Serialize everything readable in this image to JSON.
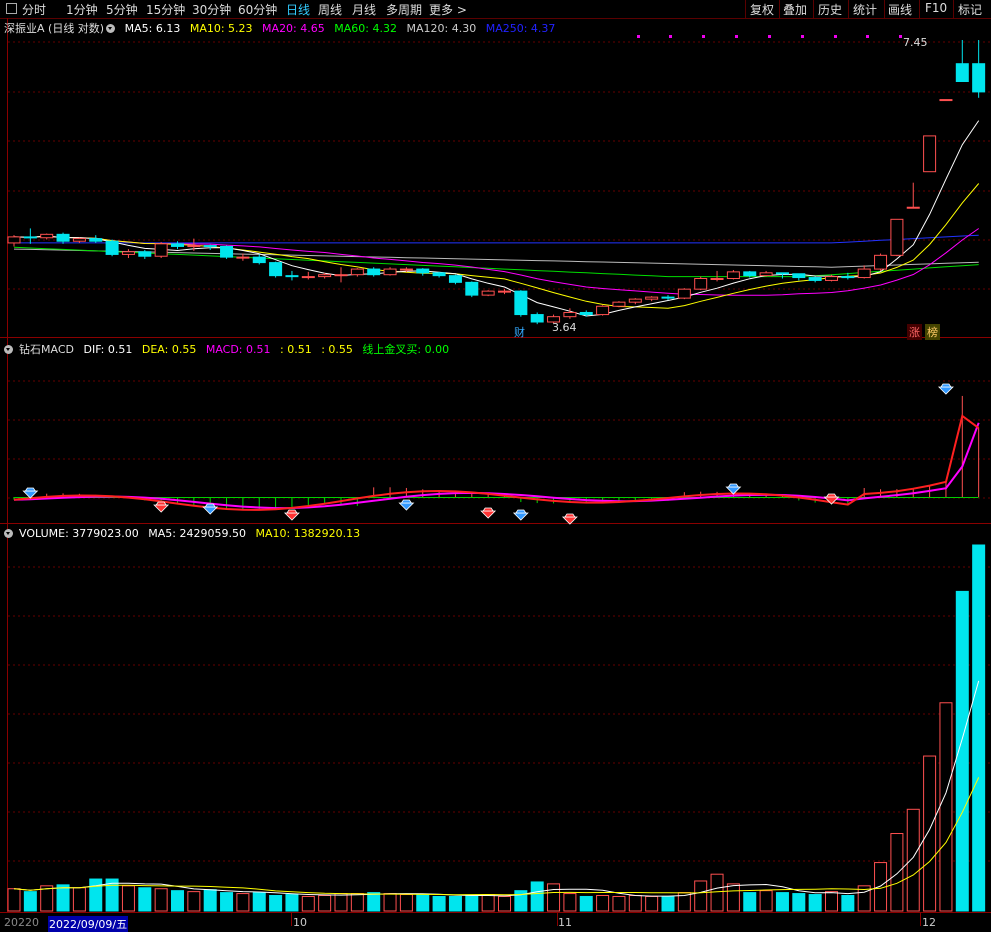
{
  "toolbar": {
    "periods": [
      "分时",
      "1分钟",
      "5分钟",
      "15分钟",
      "30分钟",
      "60分钟",
      "日线",
      "周线",
      "月线",
      "多周期",
      "更多 >"
    ],
    "active": "日线",
    "right_buttons": [
      "复权",
      "叠加",
      "历史",
      "统计",
      "画线",
      "F10",
      "标记"
    ]
  },
  "main": {
    "title": "深振业A (日线 对数)",
    "ma": [
      {
        "label": "MA5: 6.13",
        "color": "#ffffff"
      },
      {
        "label": "MA10: 5.23",
        "color": "#ffff00"
      },
      {
        "label": "MA20: 4.65",
        "color": "#ff00ff"
      },
      {
        "label": "MA60: 4.32",
        "color": "#00ff00"
      },
      {
        "label": "MA120: 4.30",
        "color": "#cccccc"
      },
      {
        "label": "MA250: 4.37",
        "color": "#0000ff"
      }
    ],
    "high_label": "7.45",
    "low_label": "3.64",
    "cai_badge": "财",
    "zhang_badge": "涨",
    "bang_badge": "榜"
  },
  "macd": {
    "title": "钻石MACD",
    "items": [
      {
        "label": "DIF: 0.51",
        "color": "#ffffff"
      },
      {
        "label": "DEA: 0.55",
        "color": "#ffff00"
      },
      {
        "label": "MACD: 0.51",
        "color": "#ff00ff"
      },
      {
        "label": ": 0.51",
        "color": "#ffff00"
      },
      {
        "label": ": 0.55",
        "color": "#ffff00"
      },
      {
        "label": "线上金叉买: 0.00",
        "color": "#00ff00"
      }
    ]
  },
  "volume": {
    "items": [
      {
        "label": "VOLUME: 3779023.00",
        "color": "#ffffff"
      },
      {
        "label": "MA5: 2429059.50",
        "color": "#ffffff"
      },
      {
        "label": "MA10: 1382920.13",
        "color": "#ffff00"
      }
    ]
  },
  "xaxis": {
    "start_label": "20220",
    "cursor_date": "2022/09/09/五",
    "month_labels": [
      "10",
      "11",
      "12"
    ]
  },
  "chart_data": {
    "type": "candlestick",
    "candles": [
      {
        "o": 4.37,
        "c": 4.44,
        "h": 4.46,
        "l": 4.33
      },
      {
        "o": 4.44,
        "c": 4.43,
        "h": 4.54,
        "l": 4.36
      },
      {
        "o": 4.43,
        "c": 4.47,
        "h": 4.48,
        "l": 4.41
      },
      {
        "o": 4.47,
        "c": 4.39,
        "h": 4.49,
        "l": 4.36
      },
      {
        "o": 4.39,
        "c": 4.42,
        "h": 4.43,
        "l": 4.37
      },
      {
        "o": 4.42,
        "c": 4.39,
        "h": 4.46,
        "l": 4.37
      },
      {
        "o": 4.39,
        "c": 4.24,
        "h": 4.41,
        "l": 4.22
      },
      {
        "o": 4.24,
        "c": 4.27,
        "h": 4.3,
        "l": 4.2
      },
      {
        "o": 4.27,
        "c": 4.22,
        "h": 4.29,
        "l": 4.19
      },
      {
        "o": 4.22,
        "c": 4.36,
        "h": 4.38,
        "l": 4.2
      },
      {
        "o": 4.36,
        "c": 4.33,
        "h": 4.39,
        "l": 4.3
      },
      {
        "o": 4.33,
        "c": 4.34,
        "h": 4.42,
        "l": 4.28
      },
      {
        "o": 4.34,
        "c": 4.33,
        "h": 4.35,
        "l": 4.29
      },
      {
        "o": 4.33,
        "c": 4.21,
        "h": 4.34,
        "l": 4.19
      },
      {
        "o": 4.21,
        "c": 4.21,
        "h": 4.25,
        "l": 4.17
      },
      {
        "o": 4.21,
        "c": 4.15,
        "h": 4.24,
        "l": 4.13
      },
      {
        "o": 4.15,
        "c": 4.01,
        "h": 4.16,
        "l": 3.99
      },
      {
        "o": 4.01,
        "c": 4.0,
        "h": 4.06,
        "l": 3.96
      },
      {
        "o": 4.0,
        "c": 4.0,
        "h": 4.05,
        "l": 3.97
      },
      {
        "o": 4.0,
        "c": 4.02,
        "h": 4.04,
        "l": 3.98
      },
      {
        "o": 4.02,
        "c": 4.02,
        "h": 4.1,
        "l": 3.94
      },
      {
        "o": 4.02,
        "c": 4.08,
        "h": 4.09,
        "l": 4.0
      },
      {
        "o": 4.08,
        "c": 4.02,
        "h": 4.1,
        "l": 4.0
      },
      {
        "o": 4.02,
        "c": 4.08,
        "h": 4.1,
        "l": 4.01
      },
      {
        "o": 4.08,
        "c": 4.08,
        "h": 4.1,
        "l": 4.05
      },
      {
        "o": 4.08,
        "c": 4.04,
        "h": 4.09,
        "l": 4.01
      },
      {
        "o": 4.04,
        "c": 4.01,
        "h": 4.05,
        "l": 3.99
      },
      {
        "o": 4.01,
        "c": 3.94,
        "h": 4.02,
        "l": 3.92
      },
      {
        "o": 3.94,
        "c": 3.81,
        "h": 3.95,
        "l": 3.79
      },
      {
        "o": 3.81,
        "c": 3.85,
        "h": 3.86,
        "l": 3.8
      },
      {
        "o": 3.85,
        "c": 3.85,
        "h": 3.87,
        "l": 3.82
      },
      {
        "o": 3.85,
        "c": 3.62,
        "h": 3.86,
        "l": 3.6
      },
      {
        "o": 3.62,
        "c": 3.55,
        "h": 3.64,
        "l": 3.53
      },
      {
        "o": 3.55,
        "c": 3.6,
        "h": 3.62,
        "l": 3.54
      },
      {
        "o": 3.6,
        "c": 3.64,
        "h": 3.68,
        "l": 3.58
      },
      {
        "o": 3.64,
        "c": 3.62,
        "h": 3.66,
        "l": 3.6
      },
      {
        "o": 3.62,
        "c": 3.7,
        "h": 3.71,
        "l": 3.61
      },
      {
        "o": 3.7,
        "c": 3.74,
        "h": 3.75,
        "l": 3.69
      },
      {
        "o": 3.74,
        "c": 3.77,
        "h": 3.78,
        "l": 3.72
      },
      {
        "o": 3.77,
        "c": 3.79,
        "h": 3.8,
        "l": 3.75
      },
      {
        "o": 3.79,
        "c": 3.78,
        "h": 3.81,
        "l": 3.76
      },
      {
        "o": 3.78,
        "c": 3.87,
        "h": 3.88,
        "l": 3.77
      },
      {
        "o": 3.87,
        "c": 3.98,
        "h": 4.0,
        "l": 3.86
      },
      {
        "o": 3.98,
        "c": 3.98,
        "h": 4.06,
        "l": 3.95
      },
      {
        "o": 3.98,
        "c": 4.05,
        "h": 4.07,
        "l": 3.97
      },
      {
        "o": 4.05,
        "c": 4.01,
        "h": 4.06,
        "l": 3.99
      },
      {
        "o": 4.01,
        "c": 4.04,
        "h": 4.06,
        "l": 4.0
      },
      {
        "o": 4.04,
        "c": 4.03,
        "h": 4.04,
        "l": 3.98
      },
      {
        "o": 4.03,
        "c": 3.99,
        "h": 4.03,
        "l": 3.96
      },
      {
        "o": 3.99,
        "c": 3.96,
        "h": 4.0,
        "l": 3.94
      },
      {
        "o": 3.96,
        "c": 4.0,
        "h": 4.02,
        "l": 3.95
      },
      {
        "o": 4.0,
        "c": 3.99,
        "h": 4.04,
        "l": 3.97
      },
      {
        "o": 3.99,
        "c": 4.08,
        "h": 4.12,
        "l": 3.98
      },
      {
        "o": 4.08,
        "c": 4.23,
        "h": 4.25,
        "l": 4.06
      },
      {
        "o": 4.23,
        "c": 4.65,
        "h": 4.65,
        "l": 4.22
      },
      {
        "o": 4.8,
        "c": 4.8,
        "h": 5.12,
        "l": 4.8
      },
      {
        "o": 5.27,
        "c": 5.79,
        "h": 5.79,
        "l": 5.27
      },
      {
        "o": 6.37,
        "c": 6.37,
        "h": 6.37,
        "l": 6.37
      },
      {
        "o": 7.0,
        "c": 6.68,
        "h": 7.45,
        "l": 6.68
      },
      {
        "o": 7.0,
        "c": 6.5,
        "h": 7.45,
        "l": 6.4
      }
    ],
    "volume": [
      230000,
      200000,
      260000,
      270000,
      240000,
      330000,
      330000,
      260000,
      240000,
      230000,
      210000,
      200000,
      220000,
      190000,
      180000,
      190000,
      160000,
      170000,
      150000,
      160000,
      180000,
      180000,
      190000,
      180000,
      170000,
      170000,
      150000,
      150000,
      160000,
      170000,
      150000,
      210000,
      300000,
      280000,
      180000,
      150000,
      160000,
      150000,
      160000,
      150000,
      150000,
      190000,
      310000,
      380000,
      280000,
      190000,
      210000,
      190000,
      180000,
      170000,
      200000,
      160000,
      260000,
      500000,
      800000,
      1050000,
      1600000,
      2150000,
      3300000,
      3779023
    ]
  }
}
